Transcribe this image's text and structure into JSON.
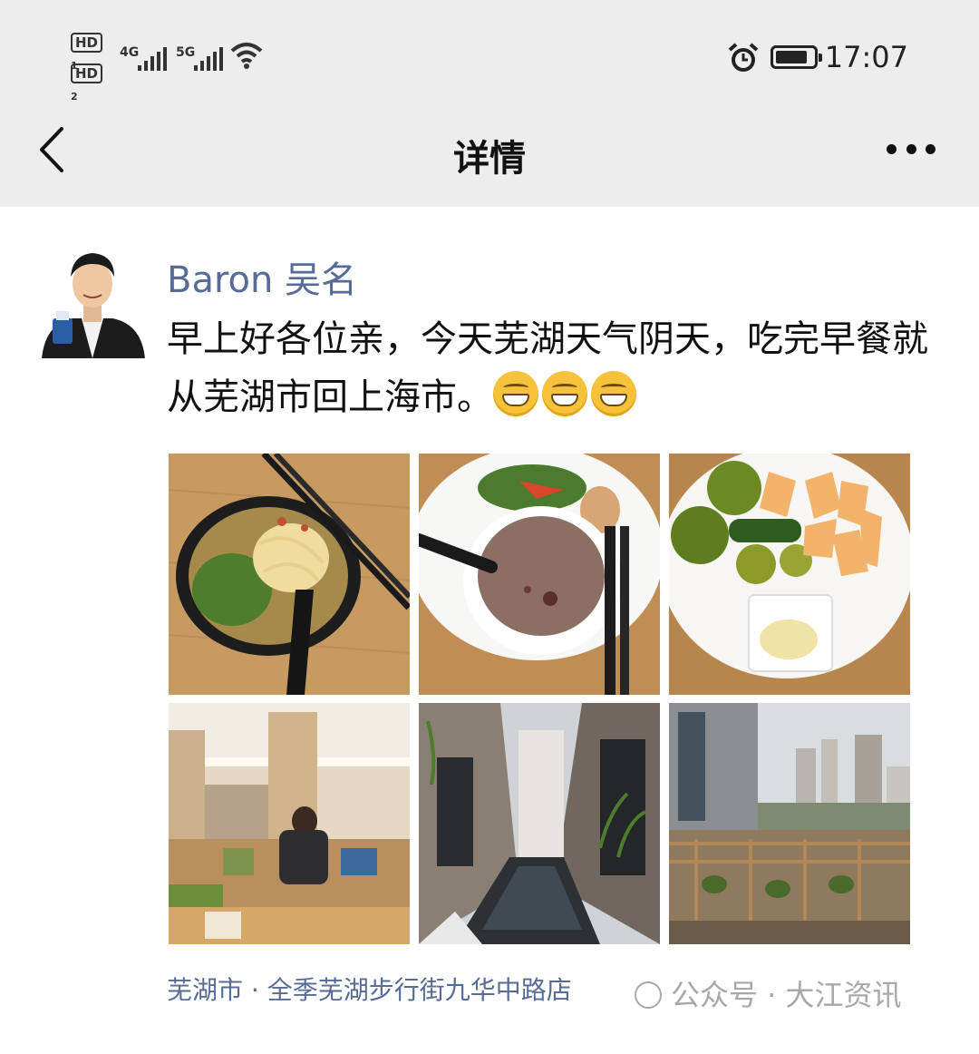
{
  "status_bar": {
    "hd1": "HD",
    "hd1_sub": "1",
    "hd2": "HD",
    "hd2_sub": "2",
    "net1": "4G",
    "net2": "5G",
    "time": "17:07",
    "battery_level": 0.85,
    "icons": [
      "hd-icon",
      "signal-icon",
      "wifi-icon",
      "alarm-icon",
      "battery-icon"
    ]
  },
  "nav": {
    "title": "详情",
    "back_icon": "chevron-left-icon",
    "more_icon": "more-icon"
  },
  "post": {
    "author": "Baron 吴名",
    "text": "早上好各位亲，今天芜湖天气阴天，吃完早餐就从芜湖市回上海市。",
    "emoji_count": 3,
    "emoji": "grin-emoji",
    "photos": [
      "noodle-bowl-photo",
      "porridge-plate-photo",
      "fruit-plate-photo",
      "restaurant-interior-photo",
      "courtyard-pool-photo",
      "city-view-photo"
    ],
    "location": "芜湖市 · 全季芜湖步行街九华中路店"
  },
  "watermark": {
    "text": "公众号 · 大江资讯"
  }
}
